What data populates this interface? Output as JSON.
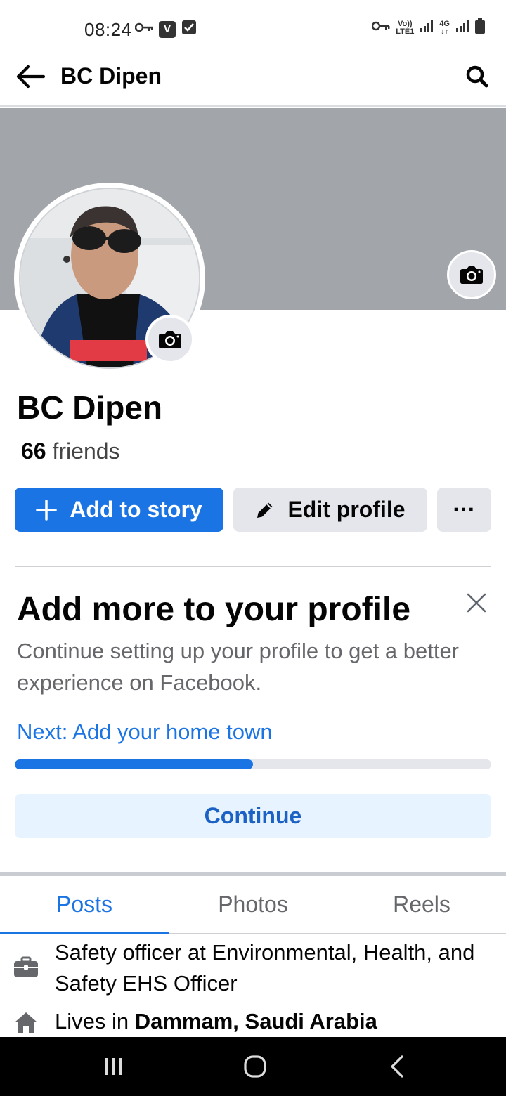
{
  "status_bar": {
    "time": "08:24",
    "left_icons": [
      "key-icon",
      "vpn-icon",
      "check-icon"
    ],
    "right_icons": [
      "key-icon",
      "volte-signal-icon",
      "4g-signal-icon",
      "battery-icon"
    ],
    "volte_label_top": "Vo))",
    "volte_label_bottom": "LTE1",
    "net_label": "4G"
  },
  "header": {
    "title": "BC Dipen",
    "back_icon": "arrow-left-icon",
    "search_icon": "search-icon"
  },
  "profile": {
    "name": "BC Dipen",
    "friends_count": "66",
    "friends_label": "friends",
    "cover_color": "#a2a6aa"
  },
  "actions": {
    "add_story": "Add to story",
    "edit_profile": "Edit profile",
    "more": "···"
  },
  "card": {
    "title": "Add more to your profile",
    "description": "Continue setting up your profile to get a better experience on Facebook.",
    "next": "Next: Add your home town",
    "progress_fraction": 0.5,
    "continue_label": "Continue"
  },
  "tabs": [
    {
      "label": "Posts",
      "active": true
    },
    {
      "label": "Photos",
      "active": false
    },
    {
      "label": "Reels",
      "active": false
    }
  ],
  "intro": {
    "work": "Safety officer at Environmental, Health, and Safety EHS Officer",
    "lives_prefix": "Lives in ",
    "lives_place": "Dammam, Saudi Arabia"
  },
  "nav": {
    "recent_icon": "recent-apps-icon",
    "home_icon": "home-circle-icon",
    "back_icon": "back-chevron-icon"
  },
  "colors": {
    "accent": "#1b74e4",
    "button_gray": "#e4e6eb",
    "continue_bg": "#e7f3ff"
  }
}
